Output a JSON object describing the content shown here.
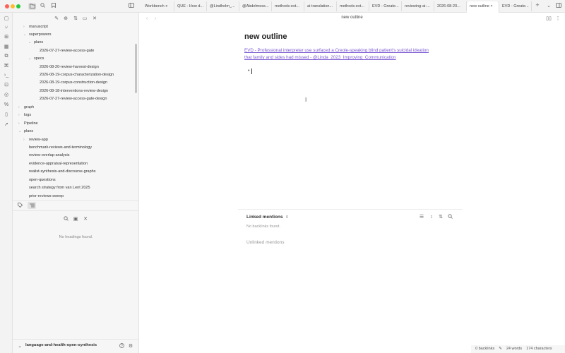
{
  "tabs": [
    {
      "label": "Workbench",
      "pinned": true
    },
    {
      "label": "QUE - How d..."
    },
    {
      "label": "@Lindholm_..."
    },
    {
      "label": "@Abdelmess..."
    },
    {
      "label": "methods-ext..."
    },
    {
      "label": "ai-translation..."
    },
    {
      "label": "methods-ext..."
    },
    {
      "label": "EVD - Greate..."
    },
    {
      "label": "reviewing-ai-..."
    },
    {
      "label": "2026-08-20..."
    },
    {
      "label": "new outline",
      "active": true,
      "close": "×"
    },
    {
      "label": "EVD - Greate..."
    }
  ],
  "tabbar_plus": "+",
  "tree": [
    {
      "label": "manuscript",
      "depth": 1,
      "chevron": "›"
    },
    {
      "label": "superpowers",
      "depth": 1,
      "chevron": "⌄"
    },
    {
      "label": "plans",
      "depth": 2,
      "chevron": "⌄"
    },
    {
      "label": "2026-07-27-review-access-gate",
      "depth": 3
    },
    {
      "label": "specs",
      "depth": 2,
      "chevron": "⌄"
    },
    {
      "label": "2026-08-20-review-harvest-design",
      "depth": 3
    },
    {
      "label": "2026-08-19-corpus-characterization-design",
      "depth": 3
    },
    {
      "label": "2026-08-19-corpus-construction-design",
      "depth": 3
    },
    {
      "label": "2026-08-18-interventions-review-design",
      "depth": 3
    },
    {
      "label": "2026-07-27-review-access-gate-design",
      "depth": 3
    },
    {
      "label": "graph",
      "depth": 0,
      "chevron": "›"
    },
    {
      "label": "logs",
      "depth": 0,
      "chevron": "›"
    },
    {
      "label": "Pipeline",
      "depth": 0,
      "chevron": "›"
    },
    {
      "label": "plans",
      "depth": 0,
      "chevron": "⌄"
    },
    {
      "label": "review-app",
      "depth": 1,
      "chevron": "›"
    },
    {
      "label": "benchmark-reviews-and-terminology",
      "depth": 1
    },
    {
      "label": "review-overlap-analysis",
      "depth": 1
    },
    {
      "label": "evidence-appraisal-representation",
      "depth": 1
    },
    {
      "label": "realist-synthesis-and-discourse-graphs",
      "depth": 1
    },
    {
      "label": "open-questions",
      "depth": 1
    },
    {
      "label": "search strategy from van Lent 2025",
      "depth": 1
    },
    {
      "label": "prior-reviews-sweep",
      "depth": 1
    }
  ],
  "outline": {
    "empty_text": "No headings found."
  },
  "vault": {
    "name": "language-and-health-open-synthesis"
  },
  "note": {
    "header_title": "new outline",
    "title": "new outline",
    "link_line1": "EVD - Professional interpreter use surfaced a Creole-speaking blind patient's suicidal ideation",
    "link_line2": "that family and sides had missed - @Linda_2023_Improving_Communication",
    "bullet": "•"
  },
  "backlinks": {
    "title": "Linked mentions",
    "count": "0",
    "empty": "No backlinks found.",
    "unlinked": "Unlinked mentions"
  },
  "status": {
    "backlinks": "0 backlinks",
    "words": "24 words",
    "chars": "174 characters"
  },
  "colors": {
    "link": "#7a57d1",
    "accent": "#7a57d1"
  }
}
